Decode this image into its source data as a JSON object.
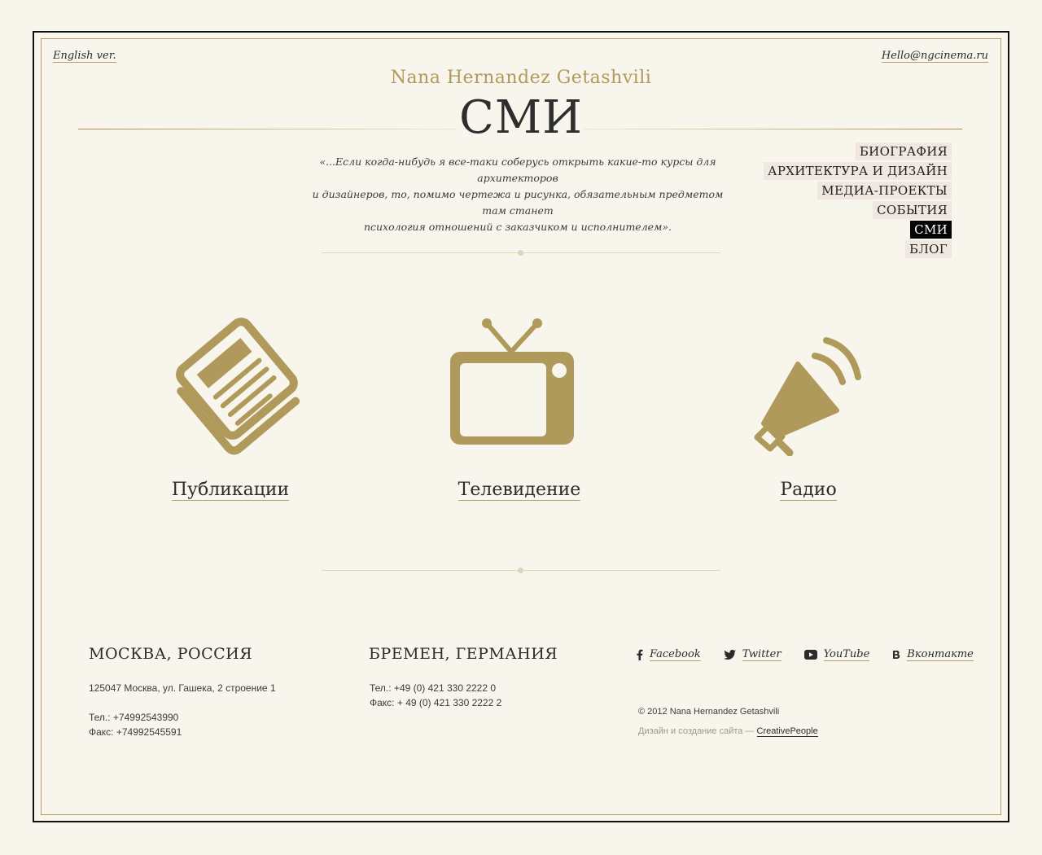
{
  "header": {
    "lang_link": "English ver.",
    "email": "Hello@ngcinema.ru",
    "author": "Nana Hernandez Getashvili",
    "title": "СМИ",
    "quote_lines": [
      "«...Если когда-нибудь я все-таки соберусь открыть какие-то курсы для архитекторов",
      "и дизайнеров, то, помимо чертежа и рисунка, обязательным предметом там станет",
      "психология отношений с заказчиком и исполнителем»."
    ]
  },
  "nav": {
    "items": [
      {
        "label": "БИОГРАФИЯ",
        "active": false
      },
      {
        "label": "АРХИТЕКТУРА И ДИЗАЙН",
        "active": false
      },
      {
        "label": "МЕДИА-ПРОЕКТЫ",
        "active": false
      },
      {
        "label": "СОБЫТИЯ",
        "active": false
      },
      {
        "label": "СМИ",
        "active": true
      },
      {
        "label": "БЛОГ",
        "active": false
      }
    ]
  },
  "media": [
    {
      "label": "Публикации",
      "icon": "newspaper-icon"
    },
    {
      "label": "Телевидение",
      "icon": "tv-icon"
    },
    {
      "label": "Радио",
      "icon": "megaphone-icon"
    }
  ],
  "footer": {
    "moscow": {
      "city": "МОСКВА, РОССИЯ",
      "address": "125047 Москва, ул. Гашека, 2 строение 1",
      "phone": "Тел.: +74992543990",
      "fax": "Факс: +74992545591"
    },
    "bremen": {
      "city": "БРЕМЕН, ГЕРМАНИЯ",
      "phone": "Тел.: +49 (0) 421 330 2222 0",
      "fax": "Факс: + 49 (0) 421 330 2222 2"
    },
    "social": [
      {
        "label": "Facebook",
        "icon": "facebook-icon"
      },
      {
        "label": "Twitter",
        "icon": "twitter-icon"
      },
      {
        "label": "YouTube",
        "icon": "youtube-icon"
      },
      {
        "label": "Вконтакте",
        "icon": "vkontakte-icon"
      }
    ],
    "copyright": "© 2012 Nana Hernandez Getashvili",
    "credits_prefix": "Дизайн и создание сайта — ",
    "credits_link": "CreativePeople"
  },
  "colors": {
    "background": "#f7f5ec",
    "gold": "#b09a5b",
    "nav_bg": "#efe7e0",
    "nav_active_bg": "#050505"
  }
}
